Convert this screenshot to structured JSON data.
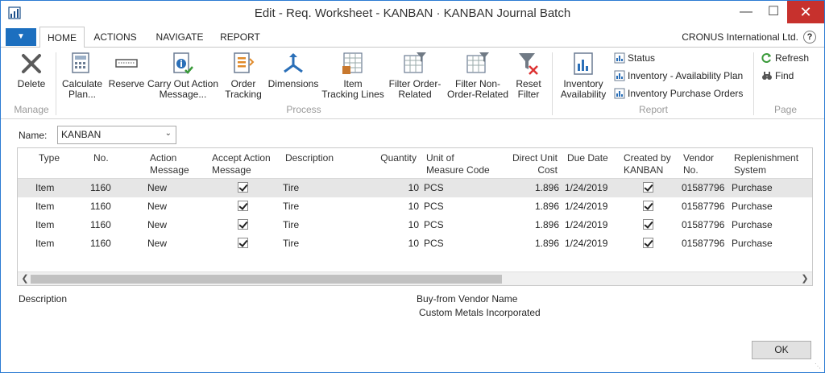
{
  "window": {
    "title": "Edit - Req. Worksheet - KANBAN · KANBAN Journal Batch",
    "minimize": "—",
    "maximize": "☐",
    "close": "✕"
  },
  "ribbon_tabs": [
    "HOME",
    "ACTIONS",
    "NAVIGATE",
    "REPORT"
  ],
  "company": "CRONUS International Ltd.",
  "help": "?",
  "groups": {
    "manage": {
      "label": "Manage",
      "buttons": [
        {
          "label": "Delete",
          "icon": "delete-x-icon"
        }
      ]
    },
    "process": {
      "label": "Process",
      "buttons": [
        {
          "label": "Calculate\nPlan...",
          "icon": "calculator-icon"
        },
        {
          "label": "Reserve",
          "icon": "reserve-icon"
        },
        {
          "label": "Carry Out Action\nMessage...",
          "icon": "carry-out-icon"
        },
        {
          "label": "Order\nTracking",
          "icon": "order-tracking-icon"
        },
        {
          "label": "Dimensions",
          "icon": "dimensions-icon"
        },
        {
          "label": "Item\nTracking Lines",
          "icon": "item-tracking-icon"
        },
        {
          "label": "Filter Order-\nRelated",
          "icon": "filter-order-icon"
        },
        {
          "label": "Filter Non-\nOrder-Related",
          "icon": "filter-non-order-icon"
        },
        {
          "label": "Reset\nFilter",
          "icon": "reset-filter-icon"
        }
      ]
    },
    "report": {
      "label": "Report",
      "big": {
        "label": "Inventory\nAvailability",
        "icon": "inventory-availability-icon"
      },
      "small": [
        {
          "label": "Status",
          "icon": "report-icon"
        },
        {
          "label": "Inventory - Availability Plan",
          "icon": "report-icon"
        },
        {
          "label": "Inventory Purchase Orders",
          "icon": "report-icon"
        }
      ]
    },
    "page": {
      "label": "Page",
      "small": [
        {
          "label": "Refresh",
          "icon": "refresh-icon"
        },
        {
          "label": "Find",
          "icon": "binoculars-icon"
        }
      ]
    }
  },
  "name_field": {
    "label": "Name:",
    "value": "KANBAN"
  },
  "grid": {
    "columns": [
      "Type",
      "No.",
      "Action\nMessage",
      "Accept Action\nMessage",
      "Description",
      "Quantity",
      "Unit of\nMeasure Code",
      "Direct Unit\nCost",
      "Due Date",
      "Created by\nKANBAN",
      "Vendor\nNo.",
      "Replenishment\nSystem"
    ],
    "rows": [
      {
        "type": "Item",
        "no": "1160",
        "action": "New",
        "accept": true,
        "description": "Tire",
        "quantity": "10",
        "uom": "PCS",
        "cost": "1.896",
        "due": "1/24/2019",
        "kanban": true,
        "vendor": "01587796",
        "system": "Purchase"
      },
      {
        "type": "Item",
        "no": "1160",
        "action": "New",
        "accept": true,
        "description": "Tire",
        "quantity": "10",
        "uom": "PCS",
        "cost": "1.896",
        "due": "1/24/2019",
        "kanban": true,
        "vendor": "01587796",
        "system": "Purchase"
      },
      {
        "type": "Item",
        "no": "1160",
        "action": "New",
        "accept": true,
        "description": "Tire",
        "quantity": "10",
        "uom": "PCS",
        "cost": "1.896",
        "due": "1/24/2019",
        "kanban": true,
        "vendor": "01587796",
        "system": "Purchase"
      },
      {
        "type": "Item",
        "no": "1160",
        "action": "New",
        "accept": true,
        "description": "Tire",
        "quantity": "10",
        "uom": "PCS",
        "cost": "1.896",
        "due": "1/24/2019",
        "kanban": true,
        "vendor": "01587796",
        "system": "Purchase"
      }
    ],
    "selected_row": 0
  },
  "factbox": {
    "description_label": "Description",
    "vendor_label": "Buy-from Vendor Name",
    "vendor_value": "Custom Metals Incorporated"
  },
  "ok_label": "OK",
  "colors": {
    "accent": "#1c6fbf",
    "close": "#c7312d",
    "selected_row": "#e6e6e6"
  }
}
